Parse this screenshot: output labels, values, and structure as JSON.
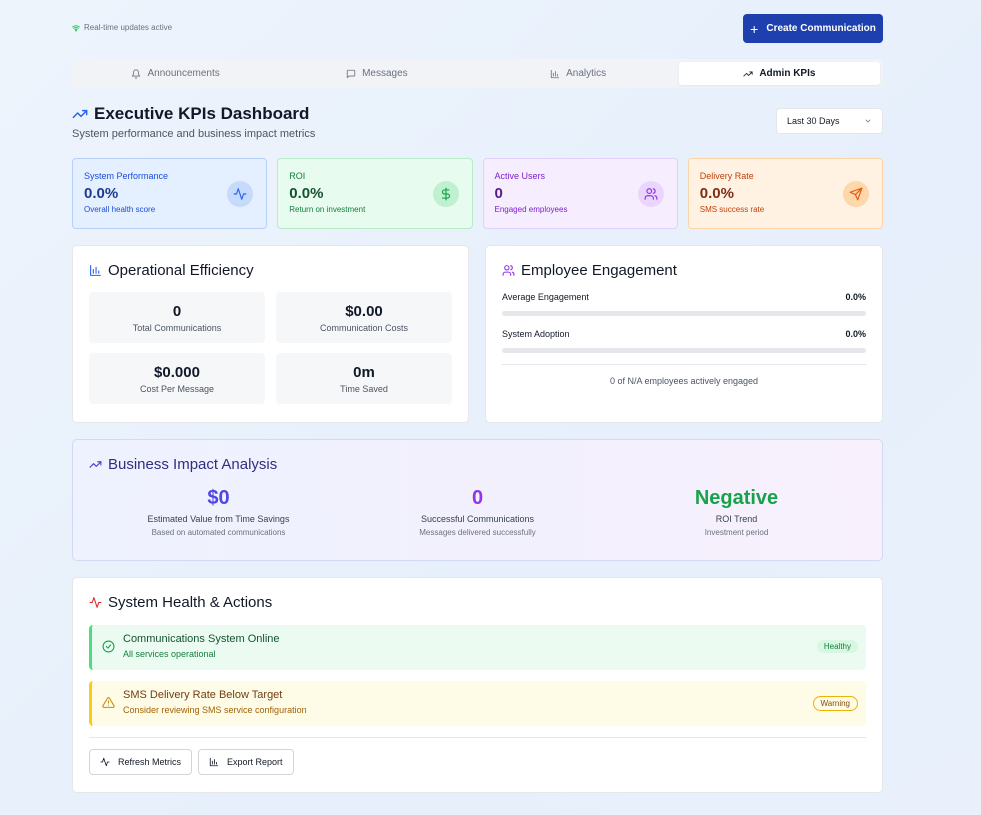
{
  "header": {
    "status_text": "Real-time updates active",
    "create_button_label": "Create Communication"
  },
  "tabs": [
    {
      "label": "Announcements",
      "icon": "bell-icon"
    },
    {
      "label": "Messages",
      "icon": "message-icon"
    },
    {
      "label": "Analytics",
      "icon": "bar-chart-icon"
    },
    {
      "label": "Admin KPIs",
      "icon": "trending-up-icon",
      "active": true
    }
  ],
  "dashboard": {
    "title": "Executive KPIs Dashboard",
    "subtitle": "System performance and business impact metrics",
    "range_selected": "Last 30 Days"
  },
  "kpis": [
    {
      "label": "System Performance",
      "value": "0.0%",
      "note": "Overall health score",
      "icon": "activity-icon",
      "color": "#2563eb"
    },
    {
      "label": "ROI",
      "value": "0.0%",
      "note": "Return on investment",
      "icon": "dollar-icon",
      "color": "#16a34a"
    },
    {
      "label": "Active Users",
      "value": "0",
      "note": "Engaged employees",
      "icon": "users-icon",
      "color": "#9333ea"
    },
    {
      "label": "Delivery Rate",
      "value": "0.0%",
      "note": "SMS success rate",
      "icon": "send-icon",
      "color": "#ea580c"
    }
  ],
  "operational": {
    "title": "Operational Efficiency",
    "cells": [
      {
        "value": "0",
        "label": "Total Communications"
      },
      {
        "value": "$0.00",
        "label": "Communication Costs"
      },
      {
        "value": "$0.000",
        "label": "Cost Per Message"
      },
      {
        "value": "0m",
        "label": "Time Saved"
      }
    ]
  },
  "engagement": {
    "title": "Employee Engagement",
    "rows": [
      {
        "label": "Average Engagement",
        "value": "0.0%",
        "fraction": 0
      },
      {
        "label": "System Adoption",
        "value": "0.0%",
        "fraction": 0
      }
    ],
    "footer": "0 of N/A employees actively engaged"
  },
  "business": {
    "title": "Business Impact Analysis",
    "cols": [
      {
        "value": "$0",
        "label": "Estimated Value from Time Savings",
        "note": "Based on automated communications",
        "color": "#4f46e5"
      },
      {
        "value": "0",
        "label": "Successful Communications",
        "note": "Messages delivered successfully",
        "color": "#9333ea"
      },
      {
        "value": "Negative",
        "label": "ROI Trend",
        "note": "Investment period",
        "color": "#16a34a"
      }
    ]
  },
  "health": {
    "title": "System Health & Actions",
    "alerts": [
      {
        "title": "Communications System Online",
        "desc": "All services operational",
        "badge": "Healthy",
        "status": "ok"
      },
      {
        "title": "SMS Delivery Rate Below Target",
        "desc": "Consider reviewing SMS service configuration",
        "badge": "Warning",
        "status": "warn"
      }
    ],
    "actions": [
      {
        "label": "Refresh Metrics",
        "icon": "activity-icon"
      },
      {
        "label": "Export Report",
        "icon": "bar-chart-icon"
      }
    ]
  }
}
